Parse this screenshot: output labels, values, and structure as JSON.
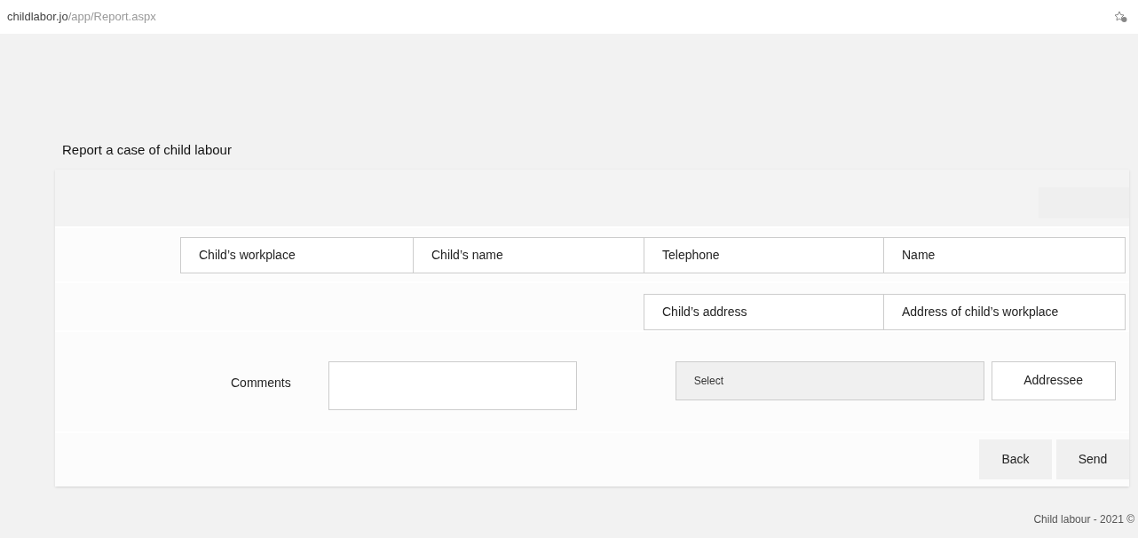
{
  "address_bar": {
    "domain": "childlabor.jo",
    "path": "/app/Report.aspx"
  },
  "form": {
    "title": "Report a case of child labour",
    "row_1": [
      {
        "placeholder": "Child’s workplace"
      },
      {
        "placeholder": "Child’s name"
      },
      {
        "placeholder": "Telephone"
      },
      {
        "placeholder": "Name"
      }
    ],
    "row_2": [
      {
        "placeholder": "Child’s address"
      },
      {
        "placeholder": "Address of child’s workplace"
      }
    ],
    "comments_label": "Comments",
    "addressee_select": "Select",
    "addressee_label": "Addressee",
    "buttons": [
      "Back",
      "Send"
    ]
  },
  "footer": "Child labour - 2021 ©"
}
